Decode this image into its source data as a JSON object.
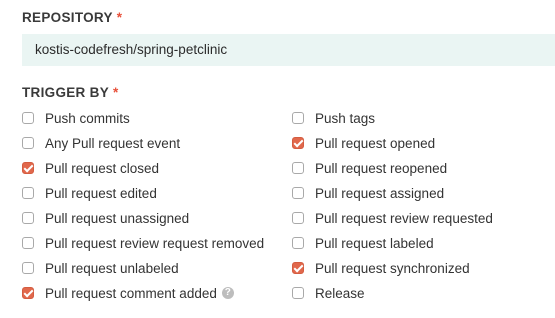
{
  "repository": {
    "label": "REPOSITORY",
    "required_marker": "*",
    "value": "kostis-codefresh/spring-petclinic"
  },
  "trigger": {
    "label": "TRIGGER BY",
    "required_marker": "*",
    "left": [
      {
        "label": "Push commits",
        "checked": false
      },
      {
        "label": "Any Pull request event",
        "checked": false
      },
      {
        "label": "Pull request closed",
        "checked": true
      },
      {
        "label": "Pull request edited",
        "checked": false
      },
      {
        "label": "Pull request unassigned",
        "checked": false
      },
      {
        "label": "Pull request review request removed",
        "checked": false
      },
      {
        "label": "Pull request unlabeled",
        "checked": false
      },
      {
        "label": "Pull request comment added",
        "checked": true
      }
    ],
    "right": [
      {
        "label": "Push tags",
        "checked": false
      },
      {
        "label": "Pull request opened",
        "checked": true
      },
      {
        "label": "Pull request reopened",
        "checked": false
      },
      {
        "label": "Pull request assigned",
        "checked": false
      },
      {
        "label": "Pull request review requested",
        "checked": false
      },
      {
        "label": "Pull request labeled",
        "checked": false
      },
      {
        "label": "Pull request synchronized",
        "checked": true
      },
      {
        "label": "Release",
        "checked": false
      }
    ],
    "help_icon": "question-circle-icon",
    "help_glyph": "?"
  },
  "colors": {
    "accent": "#e1684c",
    "required": "#e8503a",
    "field_bg": "#eaf5f3"
  }
}
